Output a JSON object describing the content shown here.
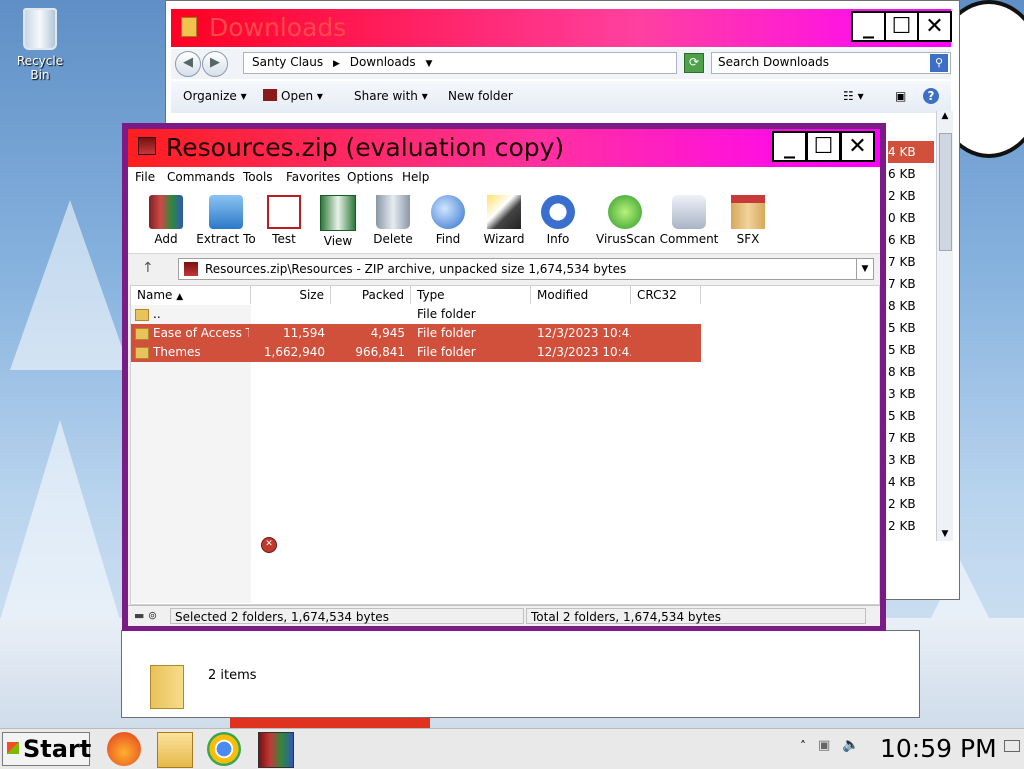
{
  "desktop": {
    "recycle_bin_label": "Recycle Bin"
  },
  "explorer": {
    "title": "Downloads",
    "breadcrumb": [
      "Santy Claus",
      "Downloads"
    ],
    "search_placeholder": "Search Downloads",
    "commands": {
      "organize": "Organize",
      "open": "Open",
      "share_with": "Share with",
      "new_folder": "New folder"
    },
    "sizes": [
      "4 KB",
      "6 KB",
      "2 KB",
      "0 KB",
      "6 KB",
      "7 KB",
      "7 KB",
      "8 KB",
      "5 KB",
      "5 KB",
      "8 KB",
      "3 KB",
      "5 KB",
      "7 KB",
      "3 KB",
      "4 KB",
      "2 KB",
      "2 KB"
    ],
    "item_count": "2 items"
  },
  "winrar": {
    "title": "Resources.zip (evaluation copy)",
    "menu": [
      "File",
      "Commands",
      "Tools",
      "Favorites",
      "Options",
      "Help"
    ],
    "toolbar": [
      "Add",
      "Extract To",
      "Test",
      "View",
      "Delete",
      "Find",
      "Wizard",
      "Info",
      "VirusScan",
      "Comment",
      "SFX"
    ],
    "path": "Resources.zip\\Resources - ZIP archive, unpacked size 1,674,534 bytes",
    "columns": [
      "Name",
      "Size",
      "Packed",
      "Type",
      "Modified",
      "CRC32"
    ],
    "rows": [
      {
        "name": "..",
        "size": "",
        "packed": "",
        "type": "File folder",
        "modified": "",
        "selected": false
      },
      {
        "name": "Ease of Access T...",
        "size": "11,594",
        "packed": "4,945",
        "type": "File folder",
        "modified": "12/3/2023 10:4...",
        "selected": true
      },
      {
        "name": "Themes",
        "size": "1,662,940",
        "packed": "966,841",
        "type": "File folder",
        "modified": "12/3/2023 10:4...",
        "selected": true
      }
    ],
    "status_left": "Selected 2 folders, 1,674,534 bytes",
    "status_right": "Total 2 folders, 1,674,534 bytes"
  },
  "taskbar": {
    "start_label": "Start",
    "clock": "10:59 PM"
  }
}
